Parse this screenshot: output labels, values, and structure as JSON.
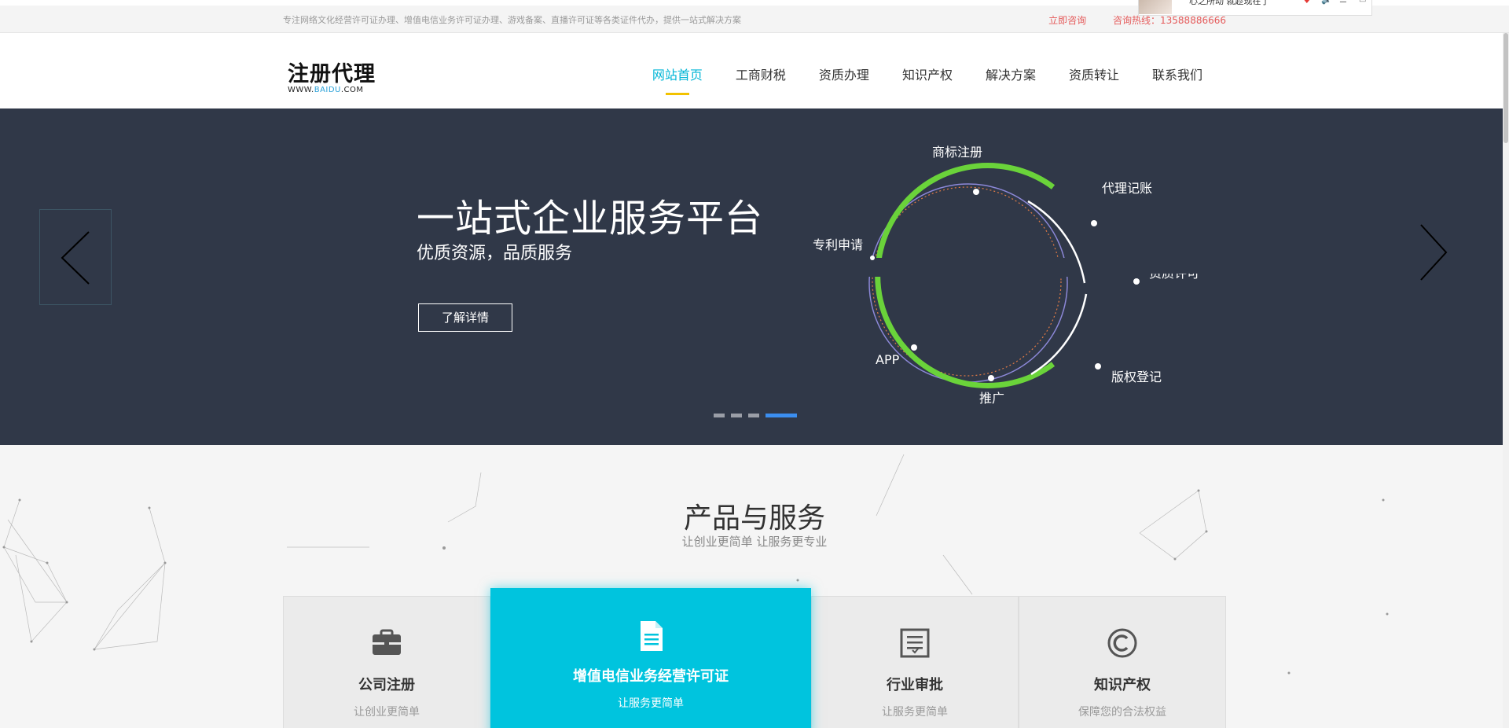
{
  "topbar": {
    "notice": "专注网络文化经营许可证办理、增值电信业务许可证办理、游戏备案、直播许可证等各类证件代办，提供一站式解决方案",
    "consult": "立即咨询",
    "hotline": "咨询热线：13588886666"
  },
  "popup": {
    "text": "心之所动 就趁现在了"
  },
  "header": {
    "logo_main": "注册代理",
    "logo_sub_prefix": "WWW.",
    "logo_sub_mid": "BAIDU",
    "logo_sub_suffix": ".COM",
    "nav": [
      {
        "label": "网站首页"
      },
      {
        "label": "工商财税"
      },
      {
        "label": "资质办理"
      },
      {
        "label": "知识产权"
      },
      {
        "label": "解决方案"
      },
      {
        "label": "资质转让"
      },
      {
        "label": "联系我们"
      }
    ]
  },
  "banner": {
    "title": "一站式企业服务平台",
    "subtitle": "优质资源，品质服务",
    "button": "了解详情",
    "ring_labels": {
      "trademark": "商标注册",
      "accounting": "代理记账",
      "patent": "专利申请",
      "license": "资质许可",
      "app": "APP",
      "promo": "推广",
      "copyright": "版权登记"
    },
    "active_slide": 4,
    "slide_count": 4
  },
  "products": {
    "title": "产品与服务",
    "subtitle": "让创业更简单 让服务更专业",
    "cards": [
      {
        "name": "公司注册",
        "desc": "让创业更简单",
        "icon": "briefcase-icon"
      },
      {
        "name": "增值电信业务经营许可证",
        "desc": "让服务更简单",
        "icon": "document-icon"
      },
      {
        "name": "行业审批",
        "desc": "让服务更简单",
        "icon": "approval-icon"
      },
      {
        "name": "知识产权",
        "desc": "保障您的合法权益",
        "icon": "copyright-icon"
      }
    ]
  },
  "colors": {
    "accent": "#00b5d6",
    "nav_underline": "#f2c200",
    "banner_bg": "#303848",
    "hotline": "#e55b5b",
    "featured_card": "#00c4de",
    "ring_green": "#6ad33a"
  }
}
